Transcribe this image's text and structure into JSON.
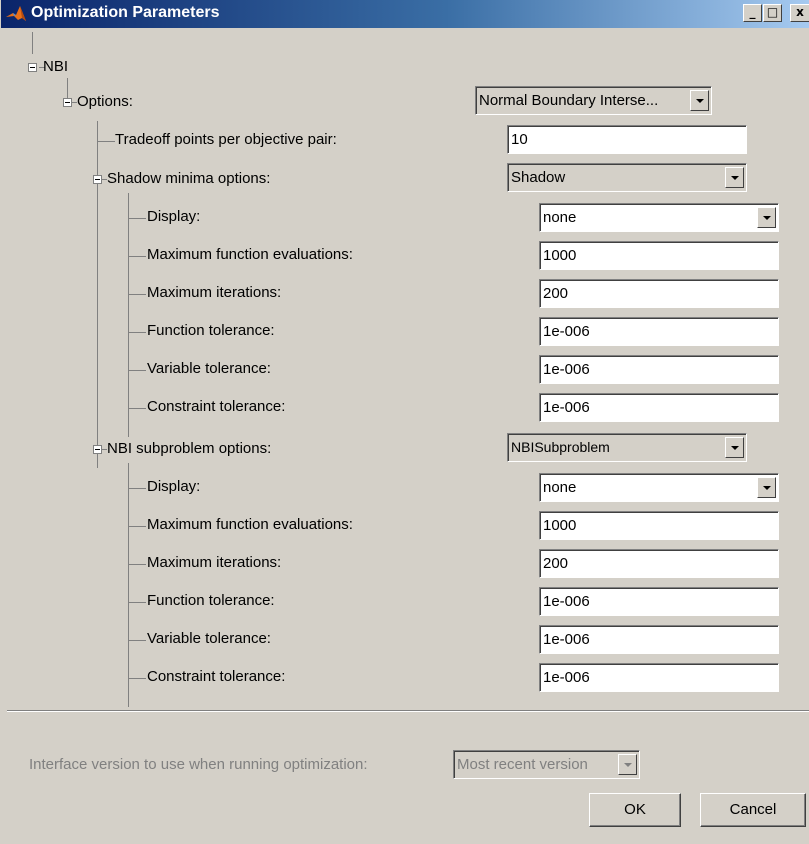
{
  "window": {
    "title": "Optimization Parameters",
    "minimize_label": "_",
    "maximize_label": "□",
    "close_label": "x"
  },
  "tree": {
    "root_label": "NBI",
    "options_label": "Options:",
    "options_value": "Normal Boundary Interse...",
    "tradeoff_label": "Tradeoff points per objective pair:",
    "tradeoff_value": "10",
    "shadow": {
      "label": "Shadow minima options:",
      "value": "Shadow",
      "display_label": "Display:",
      "display_value": "none",
      "max_fun_evals_label": "Maximum function evaluations:",
      "max_fun_evals_value": "1000",
      "max_iter_label": "Maximum iterations:",
      "max_iter_value": "200",
      "fun_tol_label": "Function tolerance:",
      "fun_tol_value": "1e-006",
      "var_tol_label": "Variable tolerance:",
      "var_tol_value": "1e-006",
      "con_tol_label": "Constraint tolerance:",
      "con_tol_value": "1e-006"
    },
    "nbi_sub": {
      "label": "NBI subproblem options:",
      "value": "NBISubproblem",
      "display_label": "Display:",
      "display_value": "none",
      "max_fun_evals_label": "Maximum function evaluations:",
      "max_fun_evals_value": "1000",
      "max_iter_label": "Maximum iterations:",
      "max_iter_value": "200",
      "fun_tol_label": "Function tolerance:",
      "fun_tol_value": "1e-006",
      "var_tol_label": "Variable tolerance:",
      "var_tol_value": "1e-006",
      "con_tol_label": "Constraint tolerance:",
      "con_tol_value": "1e-006"
    }
  },
  "interface": {
    "label": "Interface version to use when running optimization:",
    "value": "Most recent version"
  },
  "buttons": {
    "ok": "OK",
    "cancel": "Cancel"
  },
  "colors": {
    "title_gradient_start": "#0a246a",
    "title_gradient_end": "#a6caf0",
    "face": "#d4d0c8"
  }
}
